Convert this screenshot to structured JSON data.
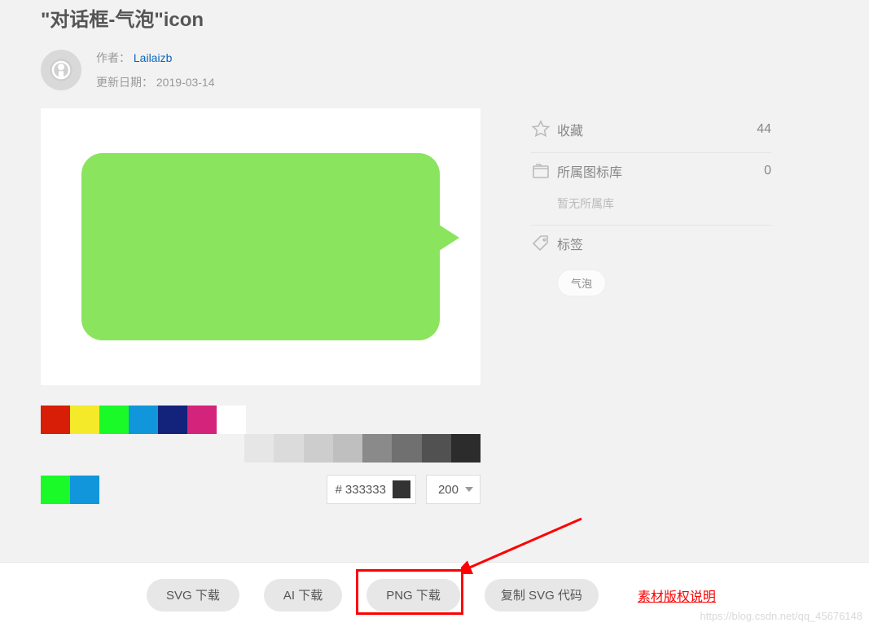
{
  "title": "\"对话框-气泡\"icon",
  "author": {
    "label": "作者：",
    "name": "Lailaizb"
  },
  "updated": {
    "label": "更新日期：",
    "value": "2019-03-14"
  },
  "stats": {
    "favorite": {
      "label": "收藏",
      "count": "44"
    },
    "library": {
      "label": "所属图标库",
      "count": "0",
      "empty": "暂无所属库"
    },
    "tags": {
      "label": "标签",
      "items": [
        "气泡"
      ]
    }
  },
  "palette": {
    "row1": [
      "#d81e06",
      "#f4ea2a",
      "#1afa29",
      "#1296db",
      "#13227a",
      "#d4237a"
    ],
    "white": "#ffffff",
    "grays": [
      "#e6e6e6",
      "#dbdbdb",
      "#cdcdcd",
      "#bfbfbf",
      "#8a8a8a",
      "#707070",
      "#515151",
      "#2c2c2c"
    ],
    "row2": [
      "#1afa29",
      "#1296db"
    ]
  },
  "hex": {
    "prefix": "#",
    "value": "333333",
    "swatch": "#333333"
  },
  "size": {
    "value": "200"
  },
  "buttons": {
    "svg": "SVG 下载",
    "ai": "AI 下载",
    "png": "PNG 下载",
    "copy_svg": "复制 SVG 代码"
  },
  "copyright_link": "素材版权说明",
  "watermark": "https://blog.csdn.net/qq_45676148"
}
